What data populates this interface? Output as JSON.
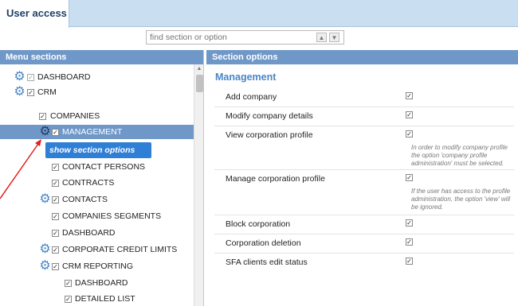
{
  "tab": {
    "label": "User access"
  },
  "search": {
    "placeholder": "find section or option",
    "up_icon": "arrow-up-icon",
    "down_icon": "arrow-down-icon"
  },
  "left": {
    "header": "Menu sections",
    "items": [
      {
        "label": "DASHBOARD",
        "checked": true,
        "gray": true,
        "gear": true
      },
      {
        "label": "CRM",
        "checked": true,
        "gear": true
      },
      {
        "label": "COMPANIES",
        "checked": true,
        "gear": false
      },
      {
        "label": "MANAGEMENT",
        "checked": true,
        "gear": true,
        "selected": true
      },
      {
        "label": "CONTACT PERSONS",
        "checked": true,
        "gear": false
      },
      {
        "label": "CONTRACTS",
        "checked": true,
        "gear": false
      },
      {
        "label": "CONTACTS",
        "checked": true,
        "gear": true
      },
      {
        "label": "COMPANIES SEGMENTS",
        "checked": true,
        "gear": false
      },
      {
        "label": "DASHBOARD",
        "checked": true,
        "gear": false
      },
      {
        "label": "CORPORATE CREDIT LIMITS",
        "checked": true,
        "gear": true
      },
      {
        "label": "CRM REPORTING",
        "checked": true,
        "gear": true
      },
      {
        "label": "DASHBOARD",
        "checked": true,
        "gear": false
      },
      {
        "label": "DETAILED LIST",
        "checked": true,
        "gear": false
      }
    ],
    "tooltip": "show section options"
  },
  "right": {
    "header": "Section options",
    "title": "Management",
    "options": [
      {
        "label": "Add company",
        "checked": true,
        "note": ""
      },
      {
        "label": "Modify company details",
        "checked": true,
        "note": ""
      },
      {
        "label": "View corporation profile",
        "checked": true,
        "note": "In order to modify company profile the option 'company profile administration' must be selected."
      },
      {
        "label": "Manage corporation profile",
        "checked": true,
        "note": "If the user has access to the profile administration, the option 'view' will be ignored."
      },
      {
        "label": "Block corporation",
        "checked": true,
        "note": ""
      },
      {
        "label": "Corporation deletion",
        "checked": true,
        "note": ""
      },
      {
        "label": "SFA clients edit status",
        "checked": true,
        "note": ""
      }
    ]
  },
  "colors": {
    "header_blue": "#6f97c8",
    "title_blue": "#4a86c6",
    "tooltip_blue": "#2f7fd6",
    "arrow_red": "#e02020"
  }
}
